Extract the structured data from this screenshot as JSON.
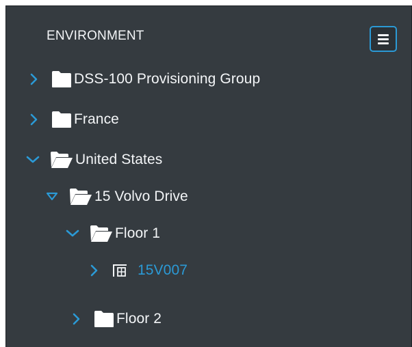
{
  "panel": {
    "title": "ENVIRONMENT",
    "menu_icon": "hamburger-menu-icon"
  },
  "tree": [
    {
      "label": "DSS-100 Provisioning Group",
      "expanded": false,
      "icon": "folder-closed-icon",
      "chevron": "chevron-right-icon"
    },
    {
      "label": "France",
      "expanded": false,
      "icon": "folder-closed-icon",
      "chevron": "chevron-right-icon"
    },
    {
      "label": "United States",
      "expanded": true,
      "icon": "folder-open-icon",
      "chevron": "chevron-down-icon"
    },
    {
      "label": "15 Volvo Drive",
      "expanded": true,
      "icon": "folder-open-icon",
      "chevron": "triangle-down-icon"
    },
    {
      "label": "Floor 1",
      "expanded": true,
      "icon": "folder-open-icon",
      "chevron": "chevron-down-icon"
    },
    {
      "label": "15V007",
      "expanded": false,
      "icon": "room-device-icon",
      "chevron": "chevron-right-icon"
    },
    {
      "label": "Floor 2",
      "expanded": false,
      "icon": "folder-closed-icon",
      "chevron": "chevron-right-icon"
    }
  ],
  "colors": {
    "panel_bg": "#353b40",
    "accent": "#2b9ad6",
    "text": "#f3f5f7"
  }
}
